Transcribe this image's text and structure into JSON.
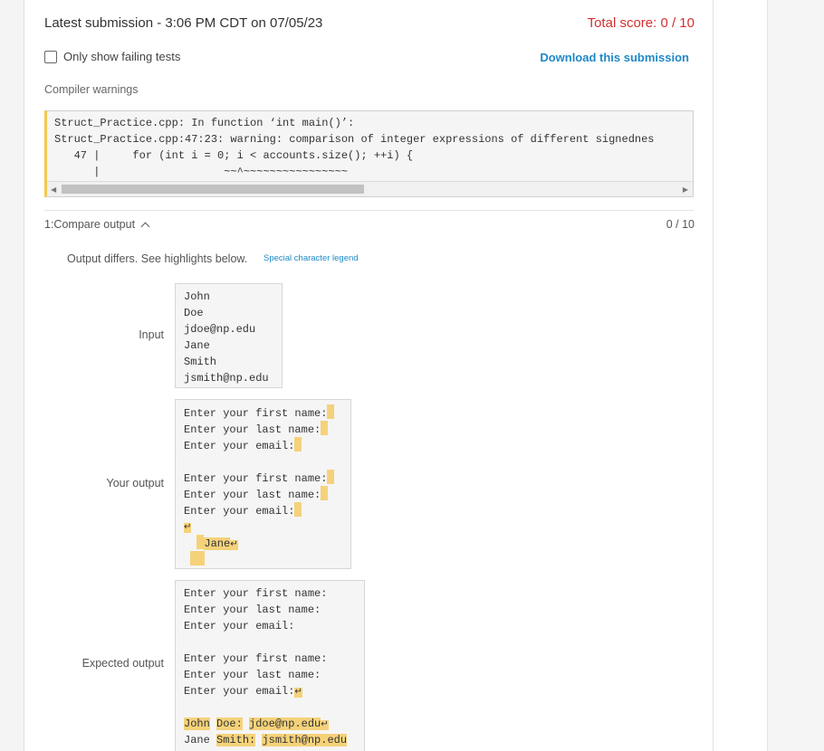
{
  "submission": {
    "latest": "Latest submission - 3:06 PM CDT on 07/05/23",
    "total_score": "Total score: 0 / 10"
  },
  "filters": {
    "only_failing_label": "Only show failing tests",
    "download_label": "Download this submission"
  },
  "compiler": {
    "label": "Compiler warnings",
    "lines": [
      "Struct_Practice.cpp: In function ‘int main()’:",
      "Struct_Practice.cpp:47:23: warning: comparison of integer expressions of different signednes",
      "   47 |     for (int i = 0; i < accounts.size(); ++i) {",
      "      |                   ~~^~~~~~~~~~~~~~~~~"
    ]
  },
  "test": {
    "title": "1:Compare output",
    "score": "0 / 10",
    "message": "Output differs. See highlights below.",
    "legend_link": "Special character legend",
    "labels": {
      "input": "Input",
      "yours": "Your output",
      "expected": "Expected output"
    },
    "input_lines": [
      "John",
      "Doe",
      "jdoe@np.edu",
      "Jane",
      "Smith",
      "jsmith@np.edu"
    ],
    "your_output": {
      "prompt_first": "Enter your first name:",
      "prompt_last": "Enter your last name:",
      "prompt_email": "Enter your email:",
      "newline_symbol": "↵",
      "name_line": "Jane"
    },
    "expected_output": {
      "prompt_first": "Enter your first name:",
      "prompt_last": "Enter your last name:",
      "prompt_email": "Enter your email:",
      "newline_symbol": "↵",
      "row1": [
        "John",
        "Doe:",
        "jdoe@np.edu"
      ],
      "row2": [
        "Jane",
        "Smith:",
        "jsmith@np.edu"
      ]
    }
  },
  "colors": {
    "score_red": "#d32f2f",
    "link_blue": "#1e88c8",
    "highlight": "#f5d27a"
  }
}
